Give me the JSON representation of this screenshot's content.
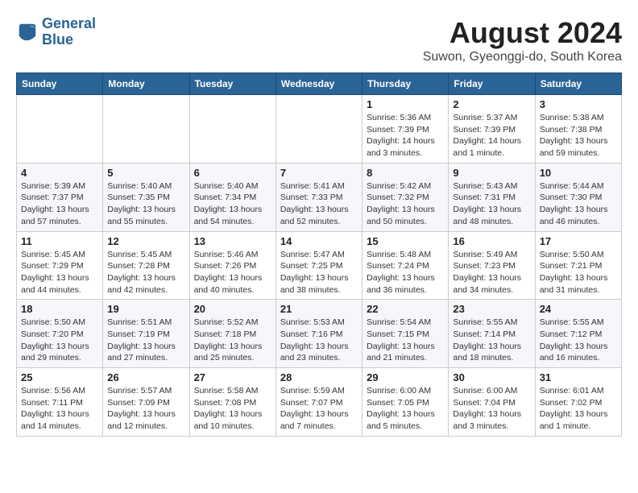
{
  "header": {
    "logo_line1": "General",
    "logo_line2": "Blue",
    "month_title": "August 2024",
    "location": "Suwon, Gyeonggi-do, South Korea"
  },
  "weekdays": [
    "Sunday",
    "Monday",
    "Tuesday",
    "Wednesday",
    "Thursday",
    "Friday",
    "Saturday"
  ],
  "weeks": [
    [
      {
        "day": "",
        "info": ""
      },
      {
        "day": "",
        "info": ""
      },
      {
        "day": "",
        "info": ""
      },
      {
        "day": "",
        "info": ""
      },
      {
        "day": "1",
        "info": "Sunrise: 5:36 AM\nSunset: 7:39 PM\nDaylight: 14 hours\nand 3 minutes."
      },
      {
        "day": "2",
        "info": "Sunrise: 5:37 AM\nSunset: 7:39 PM\nDaylight: 14 hours\nand 1 minute."
      },
      {
        "day": "3",
        "info": "Sunrise: 5:38 AM\nSunset: 7:38 PM\nDaylight: 13 hours\nand 59 minutes."
      }
    ],
    [
      {
        "day": "4",
        "info": "Sunrise: 5:39 AM\nSunset: 7:37 PM\nDaylight: 13 hours\nand 57 minutes."
      },
      {
        "day": "5",
        "info": "Sunrise: 5:40 AM\nSunset: 7:35 PM\nDaylight: 13 hours\nand 55 minutes."
      },
      {
        "day": "6",
        "info": "Sunrise: 5:40 AM\nSunset: 7:34 PM\nDaylight: 13 hours\nand 54 minutes."
      },
      {
        "day": "7",
        "info": "Sunrise: 5:41 AM\nSunset: 7:33 PM\nDaylight: 13 hours\nand 52 minutes."
      },
      {
        "day": "8",
        "info": "Sunrise: 5:42 AM\nSunset: 7:32 PM\nDaylight: 13 hours\nand 50 minutes."
      },
      {
        "day": "9",
        "info": "Sunrise: 5:43 AM\nSunset: 7:31 PM\nDaylight: 13 hours\nand 48 minutes."
      },
      {
        "day": "10",
        "info": "Sunrise: 5:44 AM\nSunset: 7:30 PM\nDaylight: 13 hours\nand 46 minutes."
      }
    ],
    [
      {
        "day": "11",
        "info": "Sunrise: 5:45 AM\nSunset: 7:29 PM\nDaylight: 13 hours\nand 44 minutes."
      },
      {
        "day": "12",
        "info": "Sunrise: 5:45 AM\nSunset: 7:28 PM\nDaylight: 13 hours\nand 42 minutes."
      },
      {
        "day": "13",
        "info": "Sunrise: 5:46 AM\nSunset: 7:26 PM\nDaylight: 13 hours\nand 40 minutes."
      },
      {
        "day": "14",
        "info": "Sunrise: 5:47 AM\nSunset: 7:25 PM\nDaylight: 13 hours\nand 38 minutes."
      },
      {
        "day": "15",
        "info": "Sunrise: 5:48 AM\nSunset: 7:24 PM\nDaylight: 13 hours\nand 36 minutes."
      },
      {
        "day": "16",
        "info": "Sunrise: 5:49 AM\nSunset: 7:23 PM\nDaylight: 13 hours\nand 34 minutes."
      },
      {
        "day": "17",
        "info": "Sunrise: 5:50 AM\nSunset: 7:21 PM\nDaylight: 13 hours\nand 31 minutes."
      }
    ],
    [
      {
        "day": "18",
        "info": "Sunrise: 5:50 AM\nSunset: 7:20 PM\nDaylight: 13 hours\nand 29 minutes."
      },
      {
        "day": "19",
        "info": "Sunrise: 5:51 AM\nSunset: 7:19 PM\nDaylight: 13 hours\nand 27 minutes."
      },
      {
        "day": "20",
        "info": "Sunrise: 5:52 AM\nSunset: 7:18 PM\nDaylight: 13 hours\nand 25 minutes."
      },
      {
        "day": "21",
        "info": "Sunrise: 5:53 AM\nSunset: 7:16 PM\nDaylight: 13 hours\nand 23 minutes."
      },
      {
        "day": "22",
        "info": "Sunrise: 5:54 AM\nSunset: 7:15 PM\nDaylight: 13 hours\nand 21 minutes."
      },
      {
        "day": "23",
        "info": "Sunrise: 5:55 AM\nSunset: 7:14 PM\nDaylight: 13 hours\nand 18 minutes."
      },
      {
        "day": "24",
        "info": "Sunrise: 5:55 AM\nSunset: 7:12 PM\nDaylight: 13 hours\nand 16 minutes."
      }
    ],
    [
      {
        "day": "25",
        "info": "Sunrise: 5:56 AM\nSunset: 7:11 PM\nDaylight: 13 hours\nand 14 minutes."
      },
      {
        "day": "26",
        "info": "Sunrise: 5:57 AM\nSunset: 7:09 PM\nDaylight: 13 hours\nand 12 minutes."
      },
      {
        "day": "27",
        "info": "Sunrise: 5:58 AM\nSunset: 7:08 PM\nDaylight: 13 hours\nand 10 minutes."
      },
      {
        "day": "28",
        "info": "Sunrise: 5:59 AM\nSunset: 7:07 PM\nDaylight: 13 hours\nand 7 minutes."
      },
      {
        "day": "29",
        "info": "Sunrise: 6:00 AM\nSunset: 7:05 PM\nDaylight: 13 hours\nand 5 minutes."
      },
      {
        "day": "30",
        "info": "Sunrise: 6:00 AM\nSunset: 7:04 PM\nDaylight: 13 hours\nand 3 minutes."
      },
      {
        "day": "31",
        "info": "Sunrise: 6:01 AM\nSunset: 7:02 PM\nDaylight: 13 hours\nand 1 minute."
      }
    ]
  ]
}
